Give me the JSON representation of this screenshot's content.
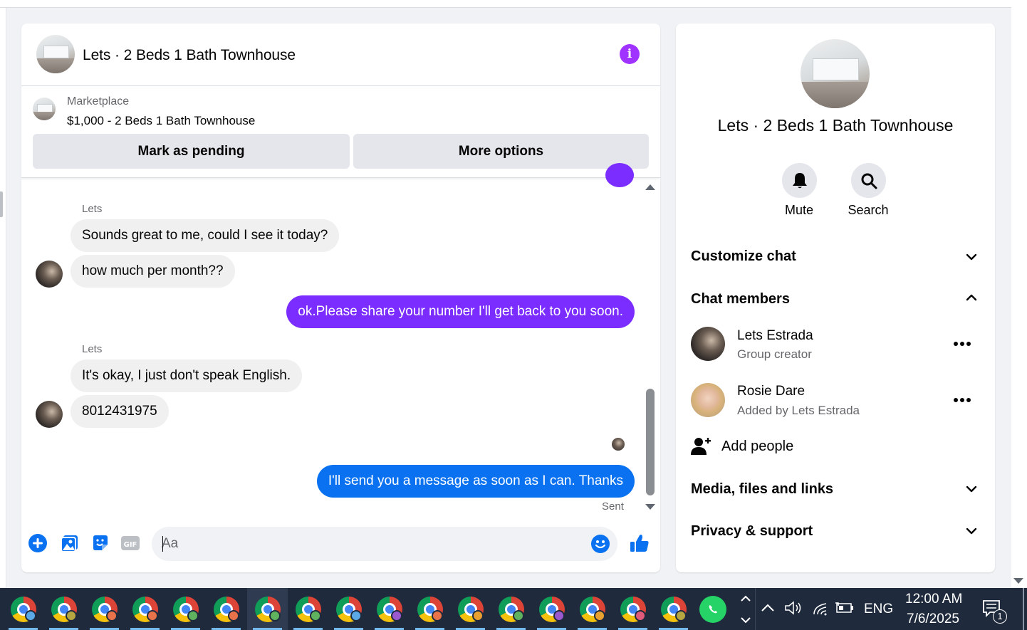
{
  "header": {
    "title": "Lets · 2 Beds 1 Bath Townhouse"
  },
  "marketplace": {
    "label": "Marketplace",
    "item": "$1,000 - 2 Beds 1 Bath Townhouse",
    "mark_pending": "Mark as pending",
    "more_options": "More options"
  },
  "messages": [
    {
      "sender": "Lets",
      "text": "Sounds great to me, could I see it today?",
      "direction": "in"
    },
    {
      "text": "how much per month??",
      "direction": "in"
    },
    {
      "text": "ok.Please share your number I'll get back to you soon.",
      "direction": "out",
      "color": "#7b2cff"
    },
    {
      "sender": "Lets",
      "text": "It's okay, I just don't speak English.",
      "direction": "in"
    },
    {
      "text": "8012431975",
      "direction": "in"
    },
    {
      "text": "I'll send you a message as soon as I can. Thanks",
      "direction": "out",
      "color": "#0a72f0"
    }
  ],
  "status": {
    "sent": "Sent"
  },
  "composer": {
    "placeholder": "Aa"
  },
  "panel": {
    "title": "Lets · 2 Beds 1 Bath Townhouse",
    "mute": "Mute",
    "search": "Search",
    "customize_chat": "Customize chat",
    "chat_members": "Chat members",
    "members": [
      {
        "name": "Lets Estrada",
        "role": "Group creator"
      },
      {
        "name": "Rosie Dare",
        "role": "Added by Lets Estrada"
      }
    ],
    "add_people": "Add people",
    "media": "Media, files and links",
    "privacy": "Privacy & support"
  },
  "taskbar": {
    "language": "ENG",
    "time": "12:00 AM",
    "date": "7/6/2025",
    "notification_count": "1",
    "badge_colors": [
      "#5aa9e6",
      "#b5a642",
      "#e8734a",
      "#e8734a",
      "#5fb35f",
      "#e8734a",
      "#5fb35f",
      "#5fb35f",
      "#5aa9e6",
      "#9b59d0",
      "#e8734a",
      "#e8a030",
      "#5fb35f",
      "#9b59d0",
      "#e8a030",
      "#e05a7a",
      "#b5a642"
    ]
  },
  "colors": {
    "accent_purple": "#a033ff",
    "bubble_purple": "#7b2cff",
    "bubble_blue": "#0a72f0",
    "icon_blue": "#0a72f0"
  }
}
